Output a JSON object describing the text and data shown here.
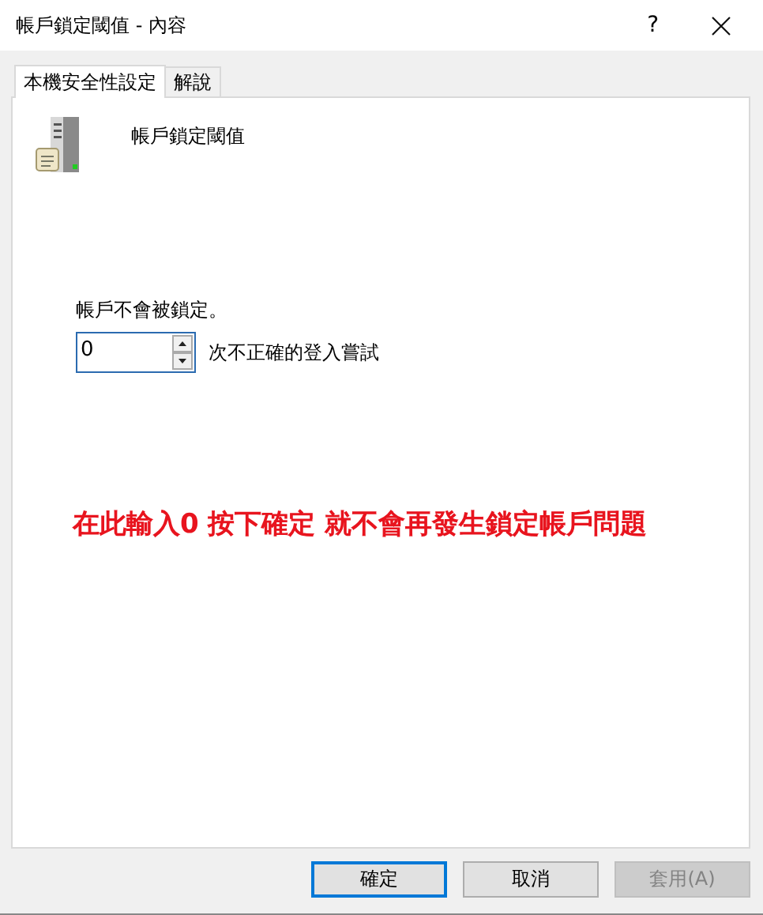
{
  "window": {
    "title": "帳戶鎖定閾值 - 內容",
    "help": "?"
  },
  "tabs": [
    {
      "label": "本機安全性設定",
      "selected": true
    },
    {
      "label": "解說",
      "selected": false
    }
  ],
  "policy": {
    "title": "帳戶鎖定閾值",
    "status": "帳戶不會被鎖定。",
    "spinner": {
      "value": "0",
      "suffix": "次不正確的登入嘗試"
    }
  },
  "annotation": "在此輸入0 按下確定 就不會再發生鎖定帳戶問題",
  "buttons": [
    {
      "label": "確定",
      "default": true,
      "disabled": false
    },
    {
      "label": "取消",
      "default": false,
      "disabled": false
    },
    {
      "label": "套用(A)",
      "default": false,
      "disabled": true
    }
  ]
}
